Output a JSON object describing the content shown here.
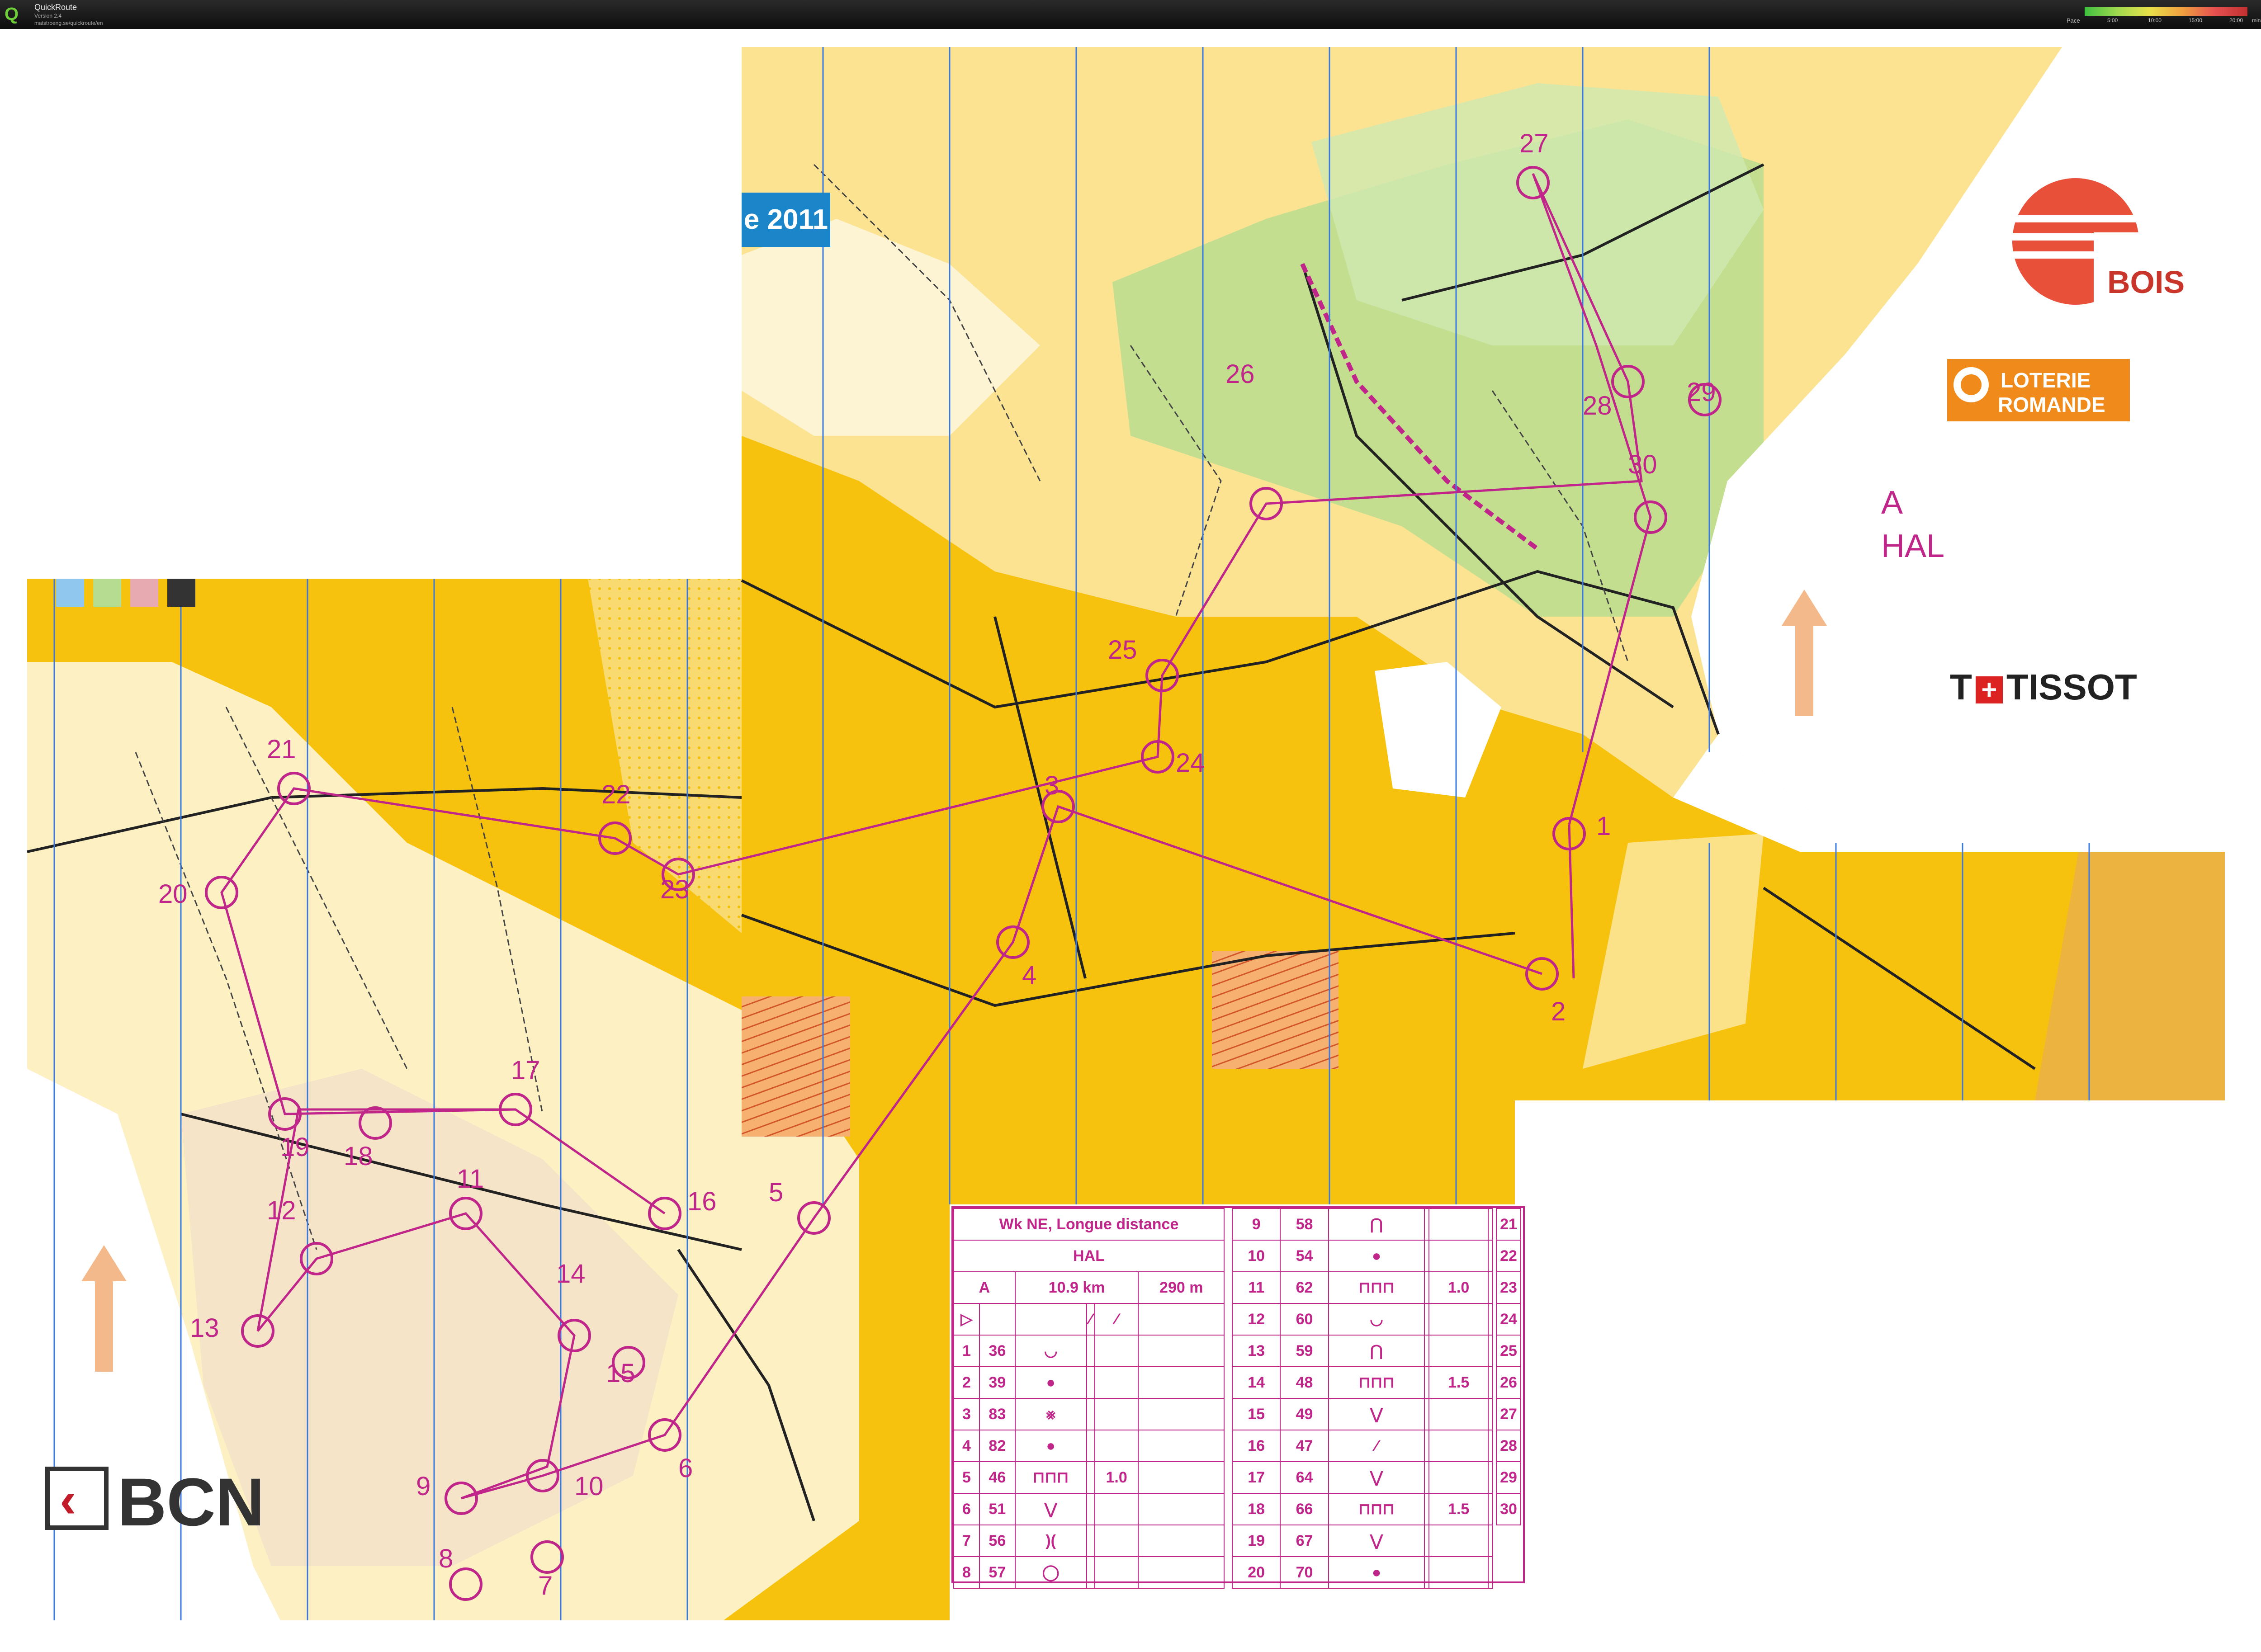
{
  "app": {
    "name": "QuickRoute",
    "version": "Version 2.4",
    "url": "matstroeng.se/quickroute/en",
    "pace_label": "Pace",
    "pace_ticks": [
      "5:00",
      "10:00",
      "15:00",
      "20:00"
    ],
    "pace_unit": "min/km"
  },
  "map": {
    "year_tag": "e 2011",
    "course_class": "A",
    "course_name": "HAL",
    "control_labels": [
      "1",
      "2",
      "3",
      "4",
      "5",
      "6",
      "7",
      "8",
      "9",
      "10",
      "11",
      "12",
      "13",
      "14",
      "15",
      "16",
      "17",
      "18",
      "19",
      "20",
      "21",
      "22",
      "23",
      "24",
      "25",
      "26",
      "27",
      "28",
      "29",
      "30"
    ],
    "colors": {
      "open": "#f6c20e",
      "forest": "#ffffff",
      "green": "#b6dc8f",
      "course": "#c0268a",
      "north_lines": "#3a79e0",
      "rough": "#fae08a"
    }
  },
  "sponsors": {
    "bcn": "BCN",
    "bois": "BOIS",
    "loterie_line1": "LOTERIE",
    "loterie_line2": "ROMANDE",
    "tissot": "TISSOT",
    "tissot_prefix": "T"
  },
  "control_descriptions": {
    "event": "Wk NE, Longue distance",
    "course": "HAL",
    "class": "A",
    "length": "10.9 km",
    "climb": "290 m",
    "rows_left": [
      {
        "n": "1",
        "code": "36",
        "sym": "◡"
      },
      {
        "n": "2",
        "code": "39",
        "sym": "●"
      },
      {
        "n": "3",
        "code": "83",
        "sym": "⨳"
      },
      {
        "n": "4",
        "code": "82",
        "sym": "●"
      },
      {
        "n": "5",
        "code": "46",
        "sym": "⊓⊓⊓",
        "dim": "1.0"
      },
      {
        "n": "6",
        "code": "51",
        "sym": "⋁"
      },
      {
        "n": "7",
        "code": "56",
        "sym": ")("
      },
      {
        "n": "8",
        "code": "57",
        "sym": "◯"
      }
    ],
    "rows_right": [
      {
        "n": "9",
        "code": "58",
        "sym": "⋂"
      },
      {
        "n": "10",
        "code": "54",
        "sym": "●"
      },
      {
        "n": "11",
        "code": "62",
        "sym": "⊓⊓⊓",
        "dim": "1.0"
      },
      {
        "n": "12",
        "code": "60",
        "sym": "◡"
      },
      {
        "n": "13",
        "code": "59",
        "sym": "⋂"
      },
      {
        "n": "14",
        "code": "48",
        "sym": "⊓⊓⊓",
        "dim": "1.5"
      },
      {
        "n": "15",
        "code": "49",
        "sym": "⋁"
      },
      {
        "n": "16",
        "code": "47",
        "sym": "⁄"
      },
      {
        "n": "17",
        "code": "64",
        "sym": "⋁"
      },
      {
        "n": "18",
        "code": "66",
        "sym": "⊓⊓⊓",
        "dim": "1.5"
      },
      {
        "n": "19",
        "code": "67",
        "sym": "⋁"
      },
      {
        "n": "20",
        "code": "70",
        "sym": "●"
      }
    ],
    "rows_third": [
      "21",
      "22",
      "23",
      "24",
      "25",
      "26",
      "27",
      "28",
      "29",
      "30"
    ]
  }
}
